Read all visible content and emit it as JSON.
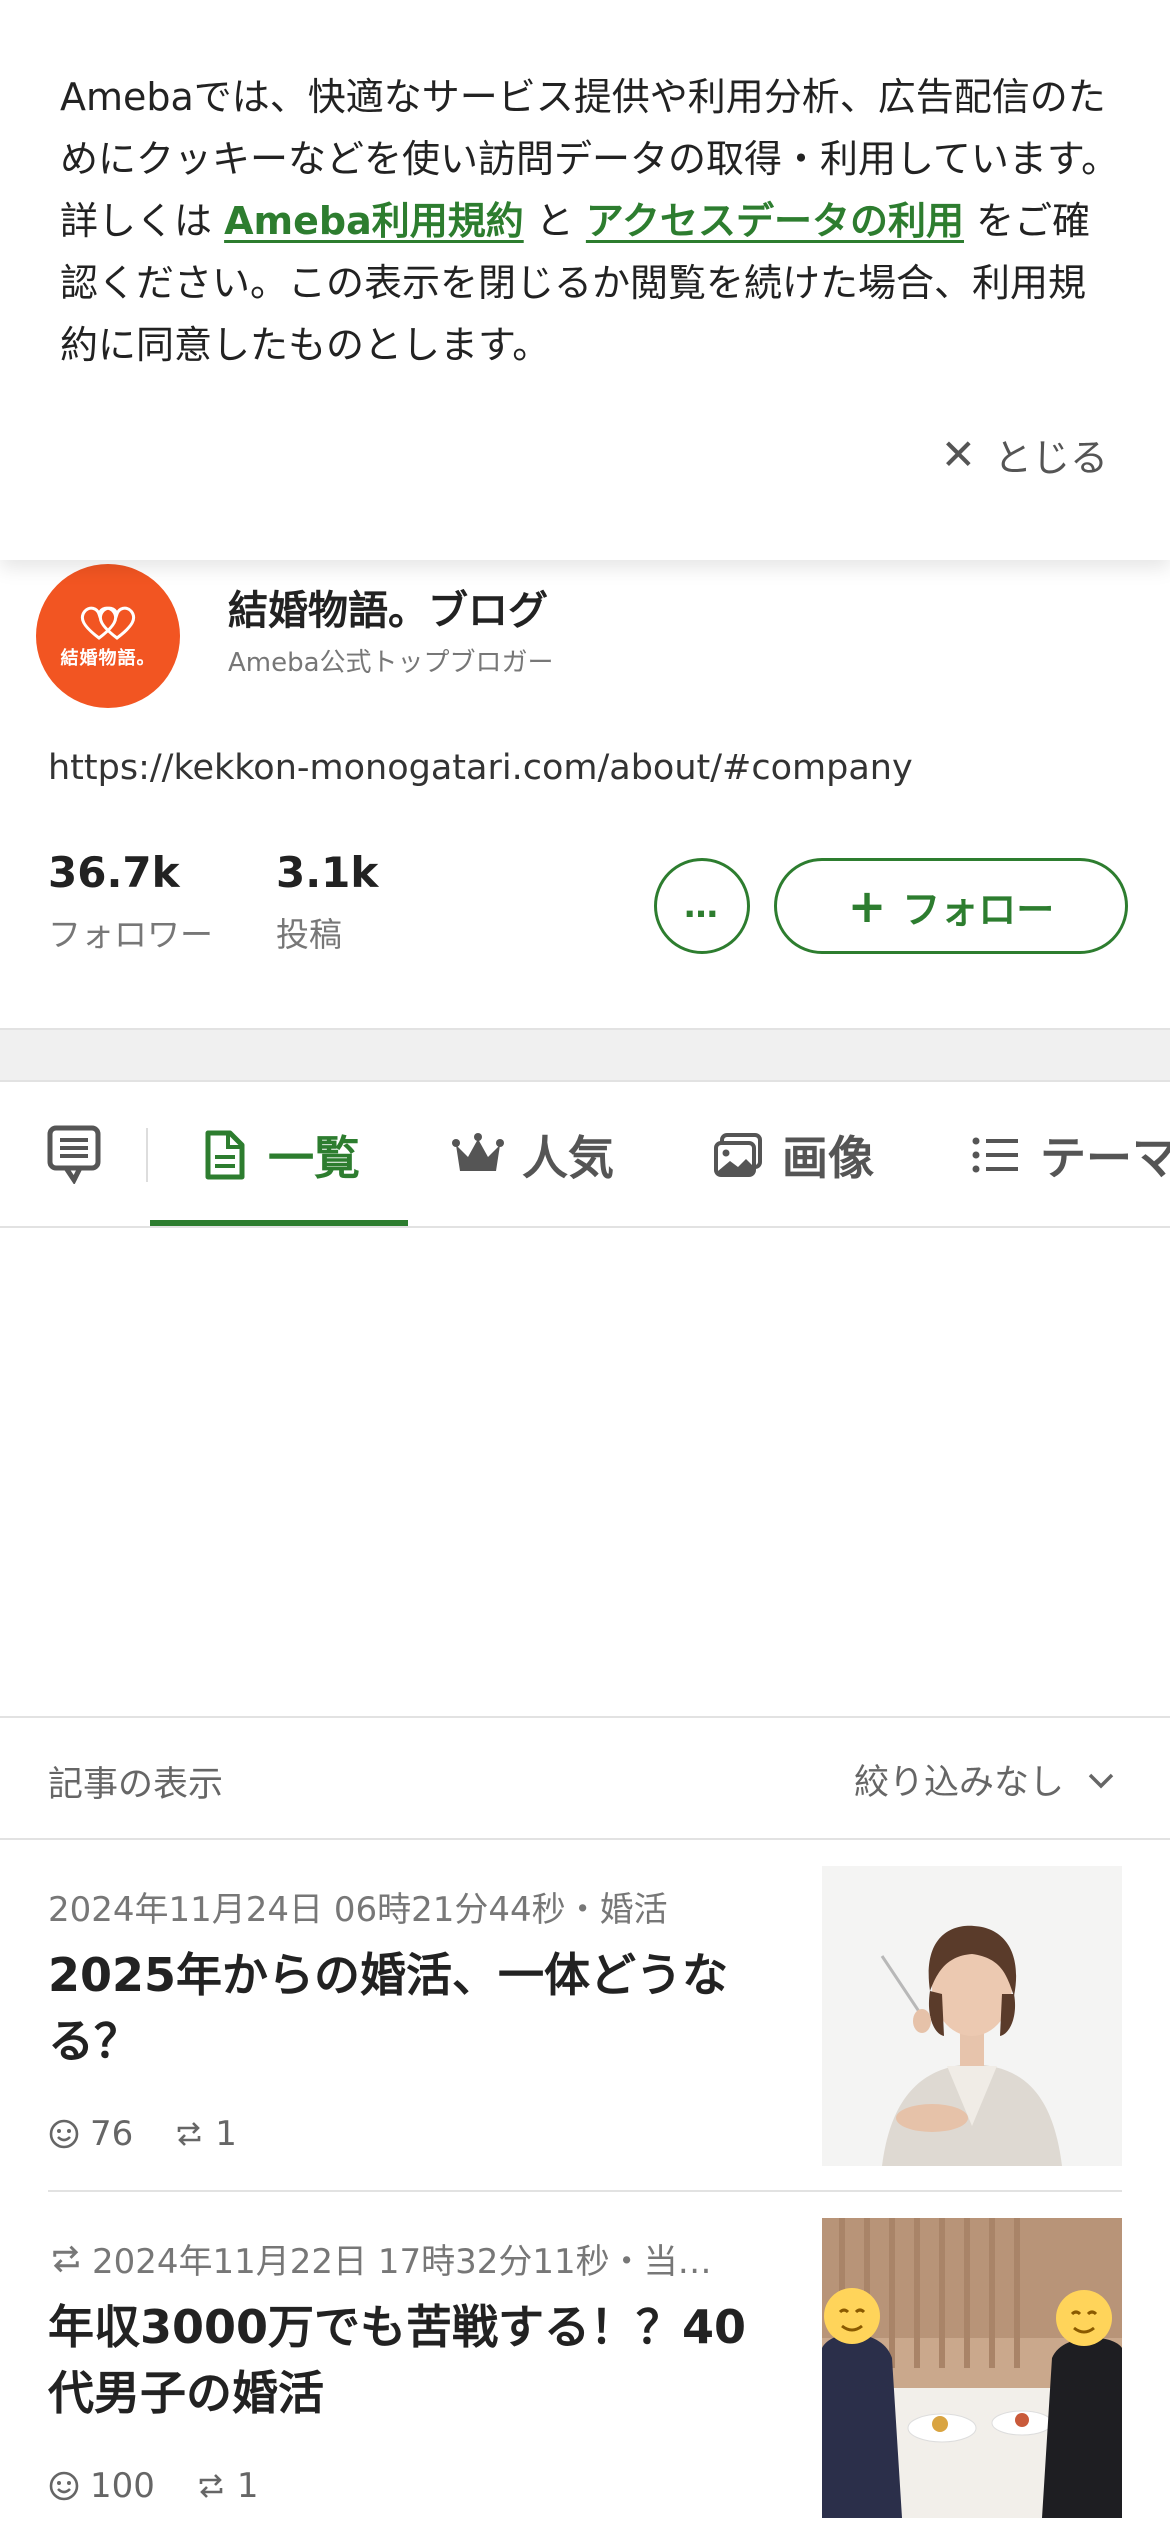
{
  "cookie": {
    "text_1": "Amebaでは、快適なサービス提供や利用分析、広告配信のためにクッキーなどを使い訪問データの取得・利用しています。詳しくは ",
    "link_terms": "Ameba利用規約",
    "text_2": " と ",
    "link_access": "アクセスデータの利用",
    "text_3": " をご確認ください。この表示を閉じるか閲覧を続けた場合、利用規約に同意したものとします。",
    "close_label": "とじる"
  },
  "profile": {
    "avatar_text": "結婚物語。",
    "name": "結婚物語。ブログ",
    "role": "Ameba公式トップブロガー",
    "url": "https://kekkon-monogatari.com/about/#company",
    "followers_value": "36.7k",
    "followers_label": "フォロワー",
    "posts_value": "3.1k",
    "posts_label": "投稿",
    "more_label": "…",
    "follow_label": "フォロー"
  },
  "tabs": {
    "list": "一覧",
    "popular": "人気",
    "images": "画像",
    "themes": "テーマ"
  },
  "filter": {
    "label": "記事の表示",
    "value": "絞り込みなし"
  },
  "articles": [
    {
      "meta": "2024年11月24日 06時21分44秒・婚活",
      "title": "2025年からの婚活、一体どうなる？",
      "likes": "76",
      "reblogs": "1",
      "reblog_icon": false
    },
    {
      "meta": "2024年11月22日 17時32分11秒・当…",
      "title": "年収3000万でも苦戦する！？40代男子の婚活",
      "likes": "100",
      "reblogs": "1",
      "reblog_icon": true
    }
  ],
  "colors": {
    "accent": "#2d7d2f",
    "avatar_bg": "#f25522"
  }
}
